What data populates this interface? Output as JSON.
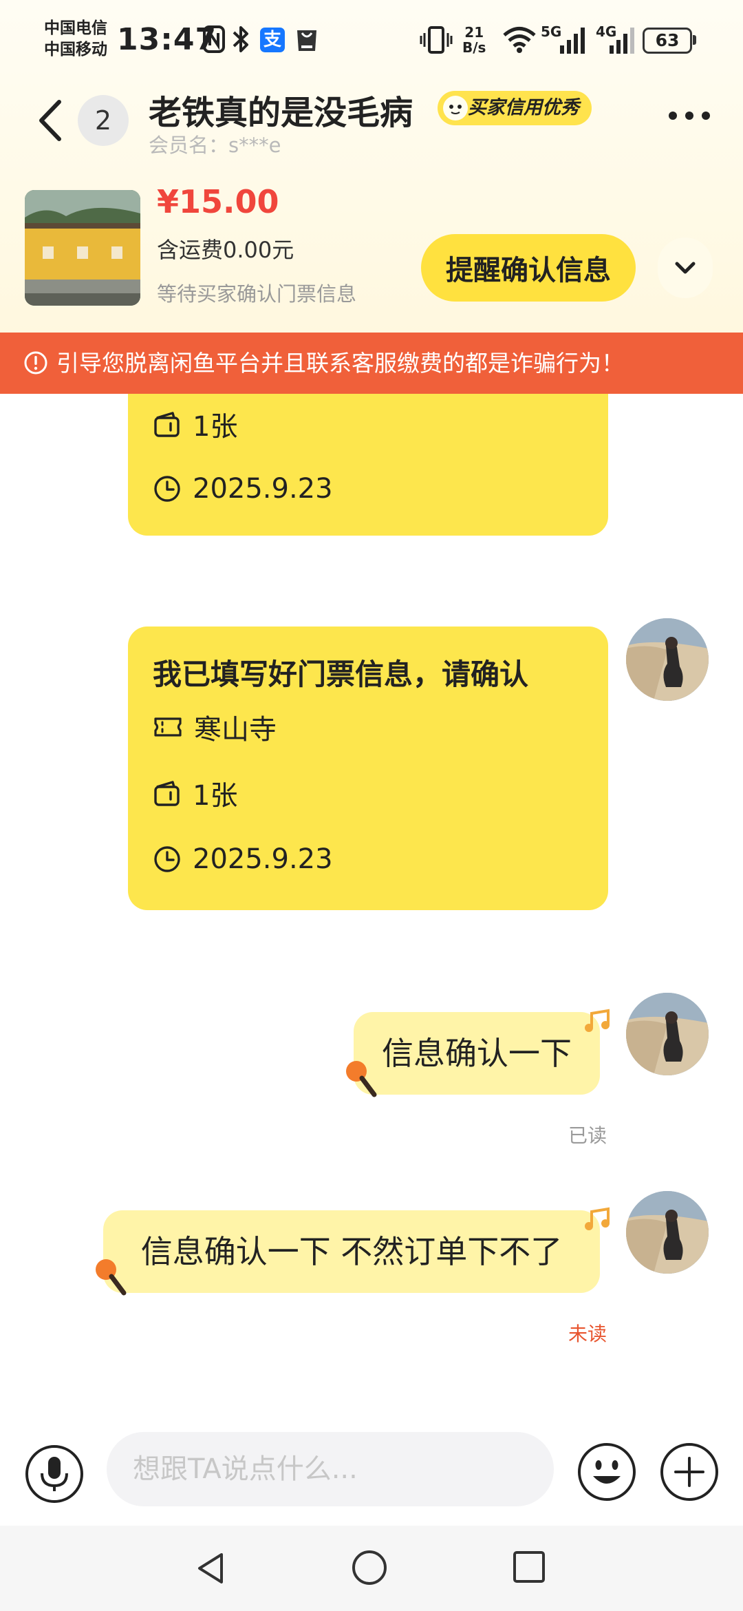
{
  "status_bar": {
    "carrier_1": "中国电信",
    "carrier_2": "中国移动",
    "time": "13:47",
    "net_speed_value": "21",
    "net_speed_unit": "B/s",
    "sig_5g": "5G",
    "sig_4g": "4G",
    "battery": "63",
    "alipay_glyph": "支"
  },
  "header": {
    "unread_count": "2",
    "title": "老铁真的是没毛病",
    "credit_badge": "买家信用优秀",
    "member_name": "会员名：s***e"
  },
  "product": {
    "price": "¥15.00",
    "shipping": "含运费0.00元",
    "status": "等待买家确认门票信息",
    "remind_button": "提醒确认信息"
  },
  "warning": {
    "text": "引导您脱离闲鱼平台并且联系客服缴费的都是诈骗行为！"
  },
  "messages": {
    "card_top": {
      "quantity": "1张",
      "date": "2025.9.23"
    },
    "card_main": {
      "title": "我已填写好门票信息，请确认",
      "venue": "寒山寺",
      "quantity": "1张",
      "date": "2025.9.23"
    },
    "msg1": {
      "text": "信息确认一下",
      "status": "已读"
    },
    "msg2": {
      "text": "信息确认一下  不然订单下不了",
      "status": "未读"
    }
  },
  "input": {
    "placeholder": "想跟TA说点什么..."
  },
  "colors": {
    "accent_yellow": "#ffe13f",
    "price_red": "#f0463c",
    "warning_orange": "#f0603a",
    "unread_red": "#e8552f",
    "read_gray": "#9a9a9a"
  },
  "icons": {
    "back": "chevron-left-icon",
    "more": "more-icon",
    "expand": "chevron-down-icon",
    "warning": "alert-circle-icon",
    "ticket": "ticket-icon",
    "quantity": "wallet-icon",
    "date": "clock-icon",
    "voice": "microphone-icon",
    "emoji": "smile-icon",
    "plus": "plus-icon"
  }
}
